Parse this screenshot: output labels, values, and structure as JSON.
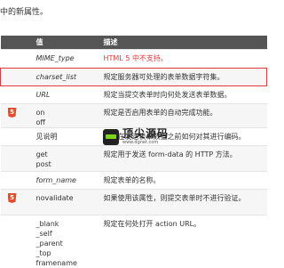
{
  "intro_text": "中的新属性。",
  "header": {
    "col_value": "值",
    "col_desc": "描述"
  },
  "rows": [
    {
      "values": [
        "MIME_type"
      ],
      "italic": true,
      "desc": "HTML 5 中不支持。",
      "desc_red": true
    },
    {
      "values": [
        "charset_list"
      ],
      "italic": true,
      "desc": "规定服务器可处理的表单数据字符集。",
      "highlighted": true
    },
    {
      "values": [
        "URL"
      ],
      "italic": true,
      "desc": "规定当提交表单时向何处发送表单数据。"
    },
    {
      "values": [
        "on",
        "off"
      ],
      "italic": false,
      "desc": "规定是否启用表单的自动完成功能。",
      "html5": true
    },
    {
      "values": [
        "见说明"
      ],
      "italic": false,
      "desc": "规定在发送表单数据之前如何对其进行编码。"
    },
    {
      "values": [
        "get",
        "post"
      ],
      "italic": false,
      "desc": "规定用于发送 form-data 的 HTTP 方法。"
    },
    {
      "values": [
        "form_name"
      ],
      "italic": true,
      "desc": "规定表单的名称。"
    },
    {
      "values": [
        "novalidate"
      ],
      "italic": false,
      "desc": "如果使用该属性，则提交表单时不进行验证。",
      "html5": true
    },
    {
      "values": [
        "_blank",
        "_self",
        "_parent",
        "_top",
        "framename"
      ],
      "italic": false,
      "desc": "规定在何处打开 action URL。"
    }
  ],
  "html5_badge": "5",
  "watermark": {
    "title": "顶尖源码",
    "url": "www.dgnet.com"
  }
}
